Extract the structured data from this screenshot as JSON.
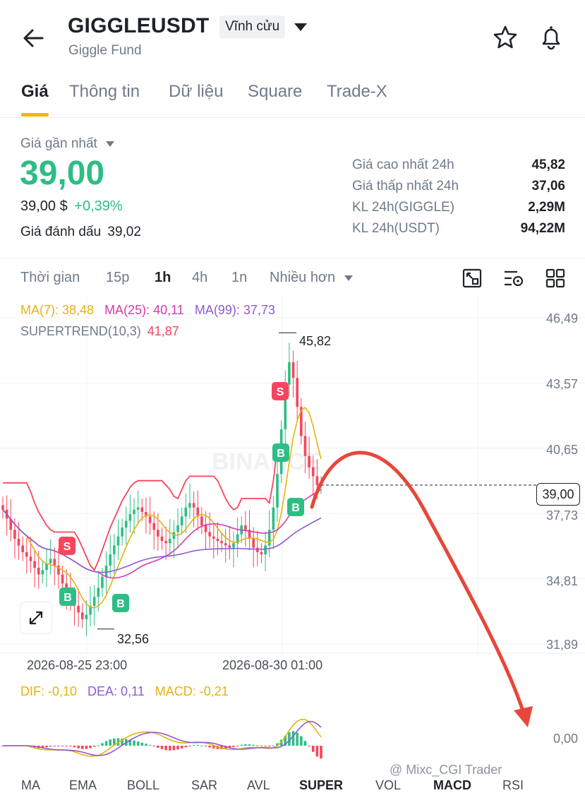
{
  "header": {
    "symbol": "GIGGLEUSDT",
    "contract_type": "Vĩnh cửu",
    "name": "Giggle Fund"
  },
  "tabs": [
    "Giá",
    "Thông tin",
    "Dữ liệu",
    "Square",
    "Trade-X"
  ],
  "active_tab": "Giá",
  "price": {
    "label": "Giá gần nhất",
    "last": "39,00",
    "usd": "39,00 $",
    "change_pct": "+0,39%",
    "mark_label": "Giá đánh dấu",
    "mark_value": "39,02"
  },
  "stats": [
    {
      "label": "Giá cao nhất 24h",
      "value": "45,82"
    },
    {
      "label": "Giá thấp nhất 24h",
      "value": "37,06"
    },
    {
      "label": "KL 24h(GIGGLE)",
      "value": "2,29M"
    },
    {
      "label": "KL 24h(USDT)",
      "value": "94,22M"
    }
  ],
  "intervals": [
    "Thời gian",
    "15p",
    "1h",
    "4h",
    "1n",
    "Nhiều hơn"
  ],
  "active_interval": "1h",
  "indicators": {
    "ma7": "MA(7): 38,48",
    "ma25": "MA(25): 40,11",
    "ma99": "MA(99): 37,73",
    "supertrend_label": "SUPERTREND(10,3)",
    "supertrend_value": "41,87"
  },
  "price_axis": [
    "46,49",
    "43,57",
    "40,65",
    "37,73",
    "34,81",
    "31,89"
  ],
  "current_price_tag": "39,00",
  "high_marker": "45,82",
  "low_marker": "32,56",
  "signal_labels": {
    "sell": "S",
    "buy": "B"
  },
  "dates": [
    "2026-08-25 23:00",
    "2026-08-30 01:00"
  ],
  "macd": {
    "dif": "DIF: -0,10",
    "dea": "DEA: 0,11",
    "macd": "MACD: -0,21",
    "axis_zero": "0,00"
  },
  "bottom_tabs": [
    "MA",
    "EMA",
    "BOLL",
    "SAR",
    "AVL",
    "SUPER",
    "VOL",
    "MACD",
    "RSI"
  ],
  "active_bottom_tab": "SUPER",
  "watermark": "@ Mixc_CGI Trader",
  "chart_watermark": "BINANCE",
  "colors": {
    "up": "#2ebd85",
    "down": "#f6465d",
    "accent": "#f0b90b",
    "ma7": "#e7b30c",
    "ma25": "#d63ab0",
    "ma99": "#8e5bd0",
    "supertrend": "#f6465d",
    "arrow": "#e8463a"
  },
  "chart_data": {
    "type": "candlestick",
    "y_range": [
      30.5,
      47.5
    ],
    "ticks": [
      46.49,
      43.57,
      40.65,
      37.73,
      34.81,
      31.89
    ],
    "high": 45.82,
    "low": 32.56,
    "last": 39.0,
    "close_series": [
      37.9,
      37.5,
      37.0,
      36.6,
      36.3,
      36.0,
      35.8,
      35.6,
      35.3,
      35.0,
      35.2,
      35.5,
      35.7,
      35.4,
      35.0,
      34.6,
      34.2,
      33.9,
      33.6,
      33.3,
      33.0,
      33.2,
      33.6,
      34.0,
      34.4,
      34.9,
      35.4,
      35.9,
      36.3,
      36.7,
      37.1,
      37.4,
      37.7,
      37.9,
      38.0,
      37.8,
      37.6,
      37.3,
      37.0,
      36.7,
      36.5,
      36.4,
      36.6,
      36.9,
      37.2,
      37.6,
      38.0,
      38.2,
      38.0,
      37.6,
      37.2,
      36.9,
      36.7,
      36.6,
      36.5,
      36.4,
      36.3,
      36.2,
      36.4,
      36.8,
      37.2,
      37.0,
      36.6,
      36.2,
      36.0,
      35.9,
      36.3,
      37.0,
      38.0,
      39.5,
      41.5,
      43.5,
      44.5,
      43.8,
      42.5,
      41.2,
      40.3,
      39.8,
      39.4,
      39.0,
      39.0
    ]
  }
}
